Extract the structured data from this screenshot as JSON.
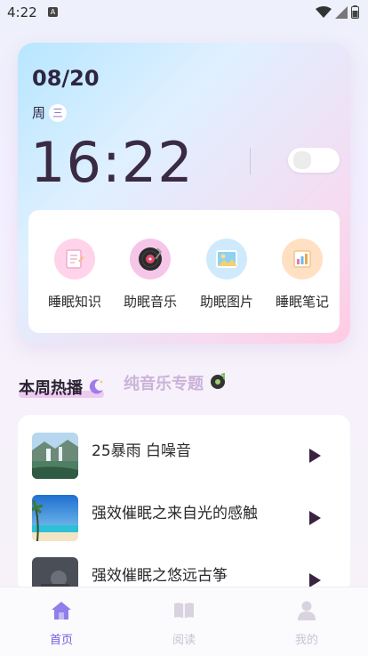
{
  "status": {
    "time": "4:22",
    "notif": "A"
  },
  "clock": {
    "date": "08/20",
    "weekday_prefix": "周",
    "weekday_char": "三",
    "time": "16:22"
  },
  "tools": [
    {
      "label": "睡眠知识",
      "icon": "notepad-icon",
      "color": "#ffd3ea"
    },
    {
      "label": "助眠音乐",
      "icon": "vinyl-record-icon",
      "color": "#f6c6e8"
    },
    {
      "label": "助眠图片",
      "icon": "picture-icon",
      "color": "#cfeafd"
    },
    {
      "label": "睡眠笔记",
      "icon": "notebook-icon",
      "color": "#ffe0c2"
    }
  ],
  "tabs": {
    "active": "本周热播",
    "inactive": "纯音乐专题"
  },
  "tracks": [
    {
      "title": "25暴雨 白噪音",
      "thumb": "waterfall-thumb"
    },
    {
      "title": "强效催眠之来自光的感触",
      "thumb": "beach-thumb"
    },
    {
      "title": "强效催眠之悠远古筝",
      "thumb": "dark-thumb"
    }
  ],
  "nav": [
    {
      "label": "首页",
      "icon": "home-icon",
      "active": true
    },
    {
      "label": "阅读",
      "icon": "book-icon",
      "active": false
    },
    {
      "label": "我的",
      "icon": "profile-icon",
      "active": false
    }
  ],
  "colors": {
    "accent": "#9b7be6",
    "nav_active": "#6b5de0",
    "nav_inactive": "#c9c3d3"
  }
}
